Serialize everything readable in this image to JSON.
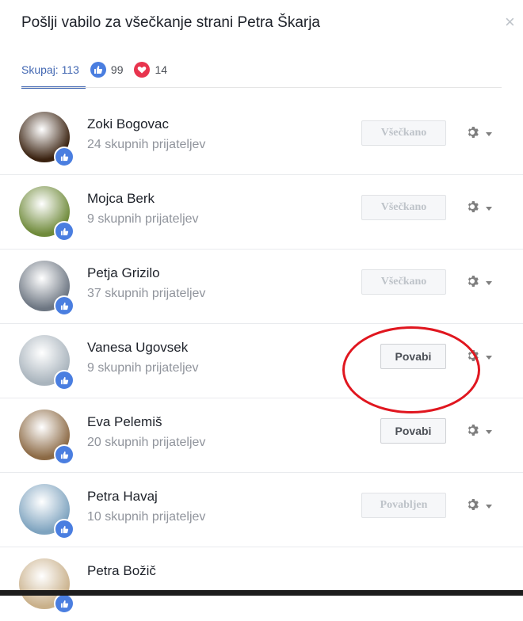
{
  "dialog": {
    "title": "Pošlji vabilo za všečkanje strani Petra Škarja",
    "close_symbol": "×"
  },
  "tabs": {
    "all_label": "Skupaj: 113",
    "likes_count": "99",
    "loves_count": "14"
  },
  "friends": [
    {
      "name": "Zoki Bogovac",
      "mutual": "24 skupnih prijateljev",
      "button": "Všečkano",
      "state": "done",
      "avatar_color": "#3a2210"
    },
    {
      "name": "Mojca Berk",
      "mutual": "9 skupnih prijateljev",
      "button": "Všečkano",
      "state": "done",
      "avatar_color": "#6f8a3a"
    },
    {
      "name": "Petja Grizilo",
      "mutual": "37 skupnih prijateljev",
      "button": "Všečkano",
      "state": "done",
      "avatar_color": "#6d7682"
    },
    {
      "name": "Vanesa Ugovsek",
      "mutual": "9 skupnih prijateljev",
      "button": "Povabi",
      "state": "invite",
      "avatar_color": "#a9b4bd"
    },
    {
      "name": "Eva Pelemiš",
      "mutual": "20 skupnih prijateljev",
      "button": "Povabi",
      "state": "invite",
      "avatar_color": "#8c6a45"
    },
    {
      "name": "Petra Havaj",
      "mutual": "10 skupnih prijateljev",
      "button": "Povabljen",
      "state": "invited",
      "avatar_color": "#7ea3bf"
    },
    {
      "name": "Petra Božič",
      "mutual": "",
      "button": "",
      "state": "partial",
      "avatar_color": "#c9b08a"
    }
  ],
  "colors": {
    "accent": "#4267b2",
    "like": "#4a7ee0",
    "love": "#e8344e",
    "highlight_circle": "#e0161f"
  },
  "icons": {
    "close": "close-icon",
    "like": "like-reaction-icon",
    "love": "love-reaction-icon",
    "settings": "gear-icon",
    "dropdown": "caret-down-icon"
  }
}
